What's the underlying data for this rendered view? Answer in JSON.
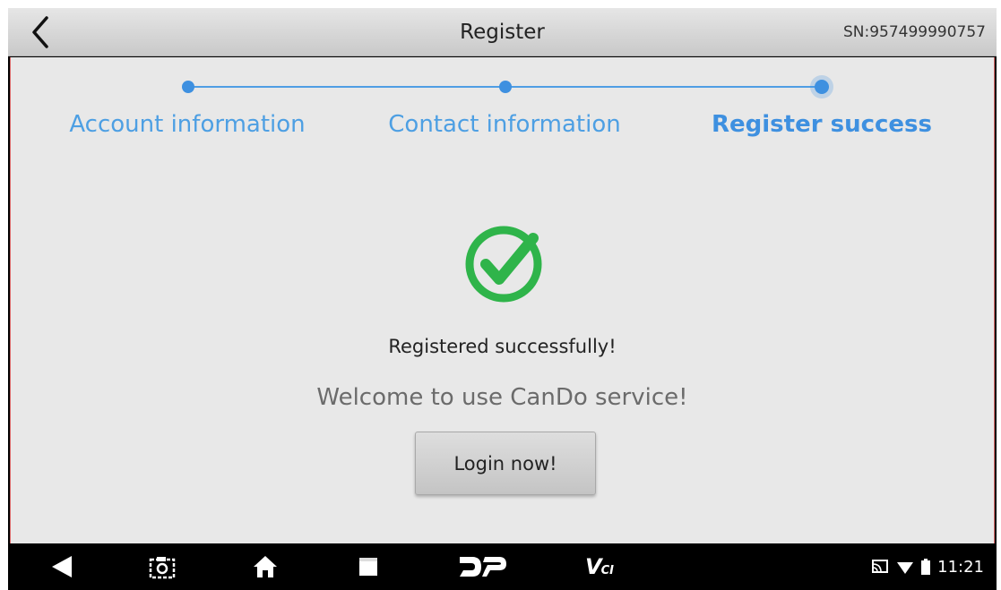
{
  "header": {
    "title": "Register",
    "serial": "SN:957499990757",
    "back_icon": "chevron-left-icon"
  },
  "steps": [
    {
      "label": "Account information",
      "active": false
    },
    {
      "label": "Contact information",
      "active": false
    },
    {
      "label": "Register success",
      "active": true
    }
  ],
  "result": {
    "icon": "check-circle-icon",
    "message": "Registered successfully!",
    "welcome": "Welcome to use CanDo service!",
    "login_label": "Login now!"
  },
  "navbar": {
    "items": [
      "back-icon",
      "screenshot-icon",
      "home-icon",
      "recents-icon",
      "dp-icon",
      "vci-icon"
    ],
    "vci_main": "V",
    "vci_sub": "CI",
    "status_icons": [
      "cast-icon",
      "wifi-icon",
      "battery-icon"
    ],
    "clock": "11:21"
  },
  "colors": {
    "accent": "#3e90e0",
    "success": "#2fb44a",
    "background": "#e8e8e8"
  }
}
